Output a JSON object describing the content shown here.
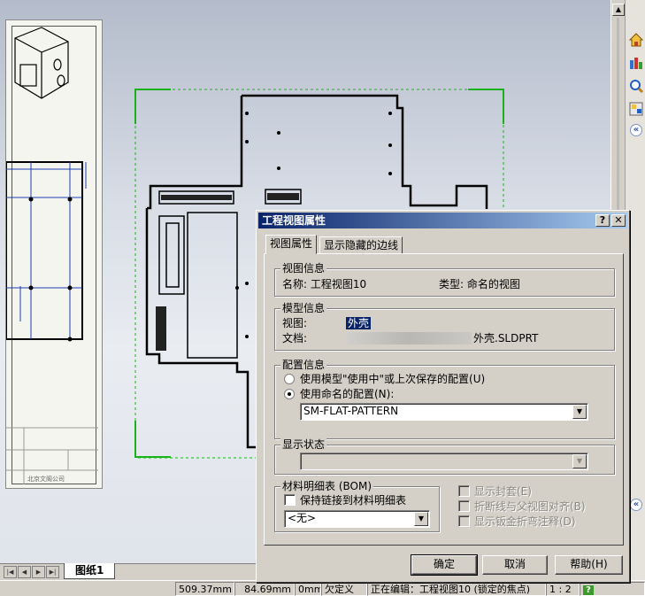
{
  "dialog": {
    "title": "工程视图属性",
    "help_btn": "?",
    "close_btn": "✕",
    "tabs": [
      "视图属性",
      "显示隐藏的边线"
    ],
    "view_info": {
      "group_label": "视图信息",
      "name_label": "名称: 工程视图10",
      "type_label": "类型: 命名的视图"
    },
    "model_info": {
      "group_label": "模型信息",
      "view_label": "视图:",
      "view_value": "外壳",
      "doc_label": "文档:",
      "doc_value": "外壳.SLDPRT"
    },
    "config_info": {
      "group_label": "配置信息",
      "option_use_model": "使用模型\"使用中\"或上次保存的配置(U)",
      "option_named": "使用命名的配置(N):",
      "selected_config": "SM-FLAT-PATTERN"
    },
    "display_state": {
      "group_label": "显示状态",
      "value": ""
    },
    "bom": {
      "group_label": "材料明细表 (BOM)",
      "keep_linked": "保持链接到材料明细表",
      "selected": "<无>"
    },
    "options": {
      "show_cover": "显示封套(E)",
      "align_broken": "折断线与父视图对齐(B)",
      "show_sheetmetal": "显示钣金折弯注释(D)"
    },
    "buttons": {
      "ok": "确定",
      "cancel": "取消",
      "help": "帮助(H)"
    }
  },
  "sheet_tab": "图纸1",
  "thumb_text": "北京文阁公司",
  "status": {
    "x": "509.37mm",
    "y": "84.69mm",
    "z": "0mm",
    "state": "欠定义",
    "editing": "正在编辑：工程视图10 (锁定的焦点)",
    "scale": "1 : 2",
    "help": "?"
  },
  "colors": {
    "title_start": "#0a246a",
    "title_end": "#a6caf0",
    "accent_green": "#19b319"
  }
}
